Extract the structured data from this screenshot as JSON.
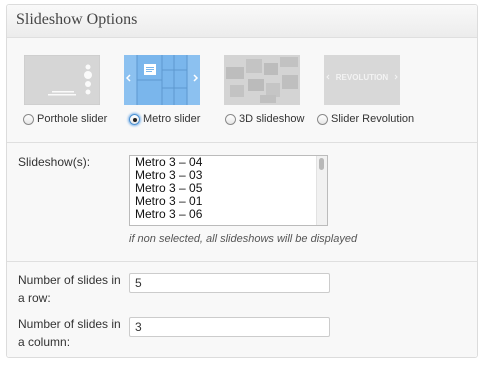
{
  "panel": {
    "title": "Slideshow Options"
  },
  "slider_types": [
    {
      "label": "Porthole slider",
      "checked": false,
      "icon": "porthole-thumbnail"
    },
    {
      "label": "Metro slider",
      "checked": true,
      "icon": "metro-thumbnail"
    },
    {
      "label": "3D slideshow",
      "checked": false,
      "icon": "3d-slideshow-thumbnail"
    },
    {
      "label": "Slider Revolution",
      "checked": false,
      "icon": "revolution-thumbnail"
    }
  ],
  "revolution_thumb_text": "REVOLUTION",
  "slideshows": {
    "label": "Slideshow(s):",
    "options": [
      "Metro 3 – 04",
      "Metro 3 – 03",
      "Metro 3 – 05",
      "Metro 3 – 01",
      "Metro 3 – 06"
    ],
    "hint": "if non selected, all slideshows will be displayed"
  },
  "slides_in_row": {
    "label_line1": "Number of slides in",
    "label_line2": "a row:",
    "value": "5"
  },
  "slides_in_column": {
    "label_line1": "Number of slides in",
    "label_line2": "a column:",
    "value": "3"
  },
  "colors": {
    "metro_active": "#7ab6ec",
    "thumb_inactive": "#d8d8d8",
    "focus_ring": "#4a8fd1"
  }
}
